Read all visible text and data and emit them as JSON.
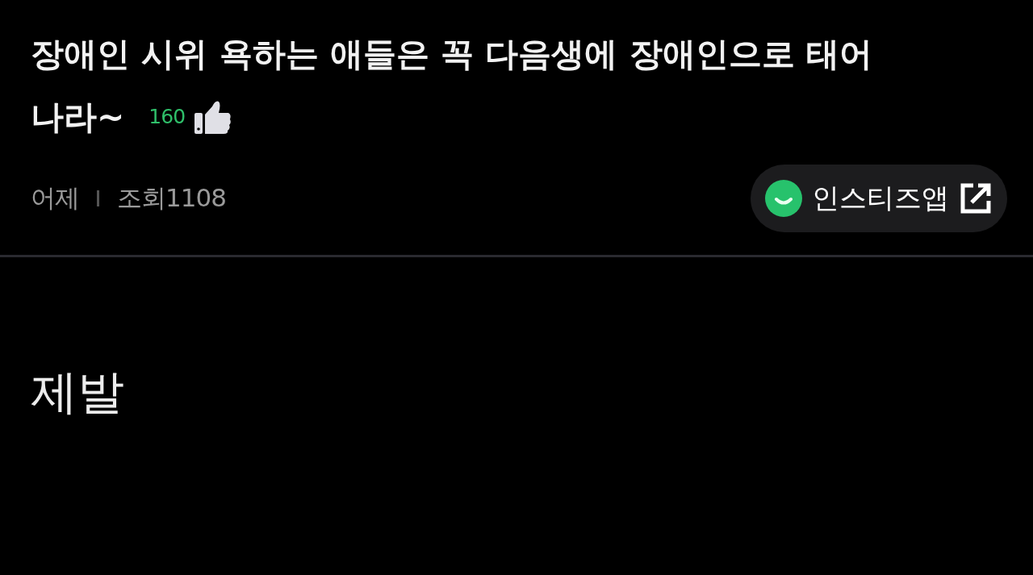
{
  "post": {
    "title_lines": [
      "장애인 시위 욕하는 애들은 꼭 다음생에 장애인으로 태어",
      "나라~"
    ],
    "likes": "160",
    "date": "어제",
    "views": "조회1108"
  },
  "app_button": {
    "label": "인스티즈앱"
  },
  "body": {
    "text": "제발"
  }
}
